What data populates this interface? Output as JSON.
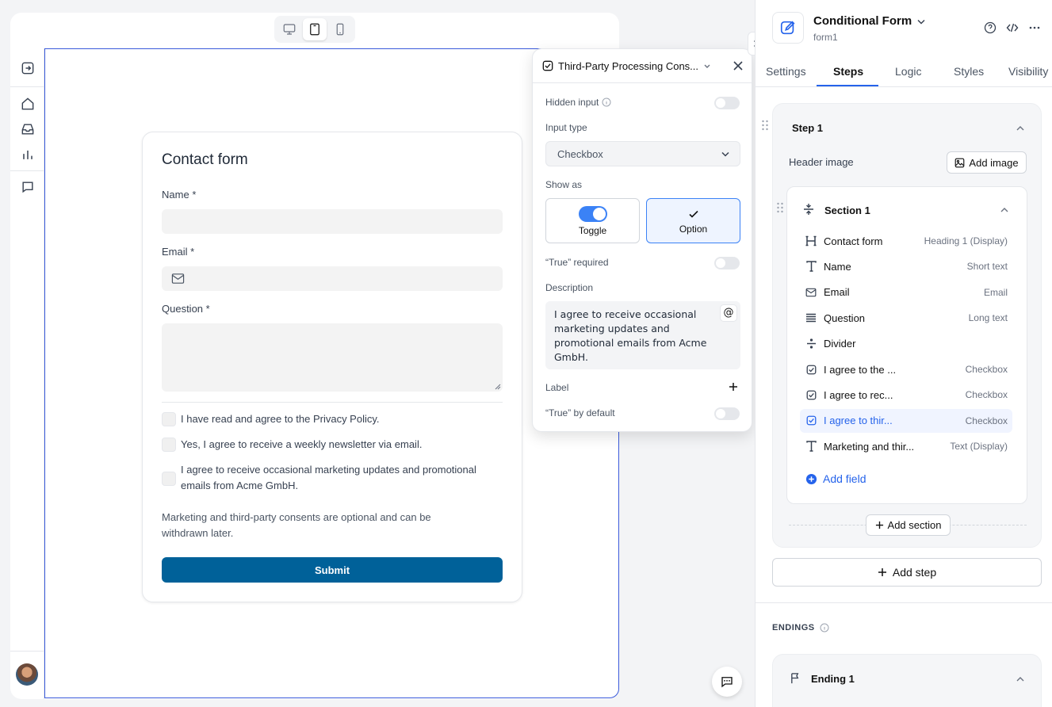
{
  "canvas": {
    "device_modes": [
      "desktop-icon",
      "tablet-icon",
      "mobile-icon"
    ],
    "active_device": "tablet-icon"
  },
  "form": {
    "title": "Contact form",
    "name_label": "Name",
    "email_label": "Email",
    "question_label": "Question",
    "required_mark": "*",
    "checkboxes": [
      "I have read and agree to the Privacy Policy.",
      "Yes, I agree to receive a weekly newsletter via email.",
      "I agree to receive occasional marketing updates and promotional emails from Acme GmbH."
    ],
    "note": "Marketing and third-party consents are optional and can be withdrawn later.",
    "submit": "Submit"
  },
  "popover": {
    "title": "Third-Party Processing Cons...",
    "hidden_input_label": "Hidden input",
    "input_type_label": "Input type",
    "input_type_value": "Checkbox",
    "show_as_label": "Show as",
    "show_as_options": [
      "Toggle",
      "Option"
    ],
    "show_as_selected": "Option",
    "true_required_label": "“True” required",
    "description_label": "Description",
    "description_value": "I agree to receive occasional marketing updates and promotional emails from Acme GmbH.",
    "mention_symbol": "@",
    "label_label": "Label",
    "true_default_label": "“True” by default"
  },
  "panel": {
    "title": "Conditional Form",
    "subtitle": "form1",
    "tabs": [
      "Settings",
      "Steps",
      "Logic",
      "Styles",
      "Visibility"
    ],
    "active_tab": "Steps",
    "step_title": "Step 1",
    "header_image_label": "Header image",
    "add_image": "Add image",
    "section_title": "Section 1",
    "fields": [
      {
        "name": "Contact form",
        "type": "Heading 1 (Display)",
        "icon": "heading-icon"
      },
      {
        "name": "Name",
        "type": "Short text",
        "icon": "text-icon"
      },
      {
        "name": "Email",
        "type": "Email",
        "icon": "mail-icon"
      },
      {
        "name": "Question",
        "type": "Long text",
        "icon": "long-text-icon"
      },
      {
        "name": "Divider",
        "type": "",
        "icon": "divider-icon"
      },
      {
        "name": "I agree to the ...",
        "type": "Checkbox",
        "icon": "checkbox-icon"
      },
      {
        "name": "I agree to rec...",
        "type": "Checkbox",
        "icon": "checkbox-icon"
      },
      {
        "name": "I agree to thir...",
        "type": "Checkbox",
        "icon": "checkbox-icon"
      },
      {
        "name": "Marketing and thir...",
        "type": "Text (Display)",
        "icon": "text-icon"
      }
    ],
    "selected_field_index": 7,
    "add_field": "Add field",
    "add_section": "Add section",
    "add_step": "Add step",
    "endings_label": "ENDINGS",
    "ending_title": "Ending 1"
  },
  "colors": {
    "accent": "#2563eb",
    "submit_bg": "#006199",
    "frame_border": "#3b5bdb"
  }
}
